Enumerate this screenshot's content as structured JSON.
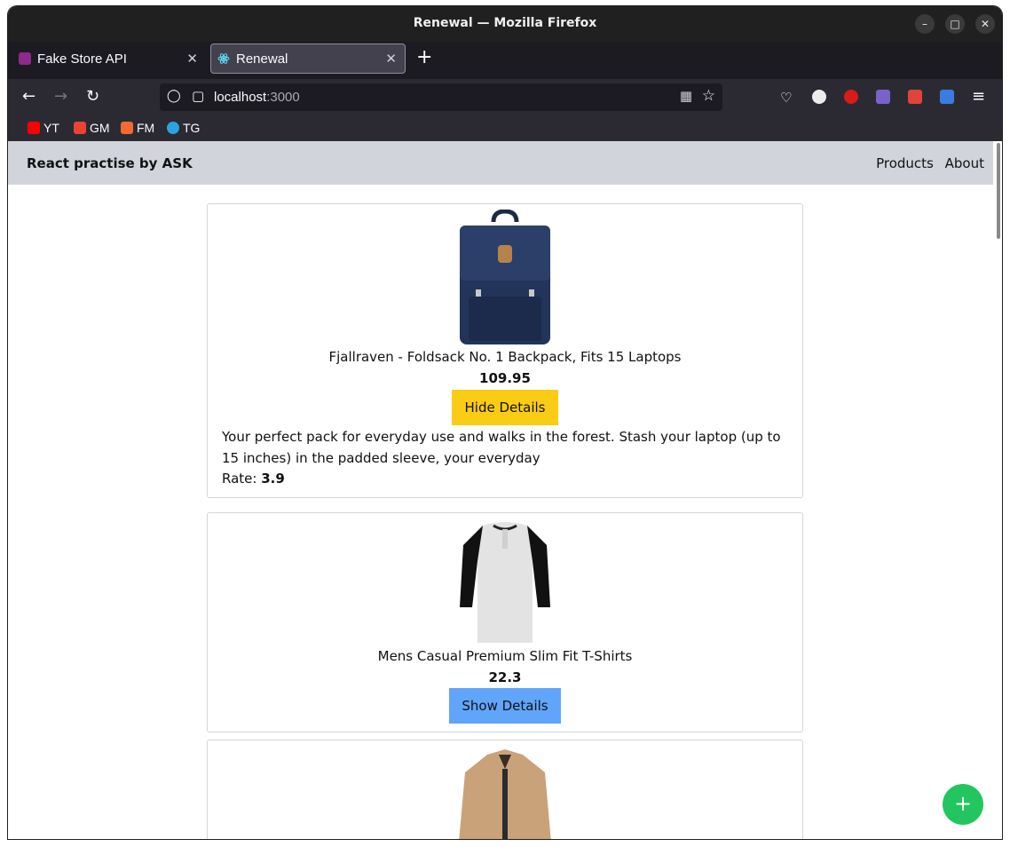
{
  "window": {
    "title": "Renewal — Mozilla Firefox"
  },
  "tabs": [
    {
      "label": "Fake Store API",
      "active": false
    },
    {
      "label": "Renewal",
      "active": true
    }
  ],
  "address": {
    "host": "localhost",
    "port": ":3000"
  },
  "bookmarks": [
    "YT",
    "GM",
    "FM",
    "TG"
  ],
  "app": {
    "brand": "React practise by ASK",
    "nav": [
      "Products",
      "About"
    ]
  },
  "products": [
    {
      "title": "Fjallraven - Foldsack No. 1 Backpack, Fits 15 Laptops",
      "price": "109.95",
      "button": "Hide Details",
      "description": "Your perfect pack for everyday use and walks in the forest. Stash your laptop (up to 15 inches) in the padded sleeve, your everyday",
      "rate_label": "Rate:",
      "rate": "3.9"
    },
    {
      "title": "Mens Casual Premium Slim Fit T-Shirts",
      "price": "22.3",
      "button": "Show Details"
    }
  ],
  "fab": {
    "label": "+"
  },
  "colors": {
    "nav_bg": "#d1d5db",
    "hide_btn": "#facc15",
    "show_btn": "#60a5fa",
    "fab": "#22c55e"
  }
}
